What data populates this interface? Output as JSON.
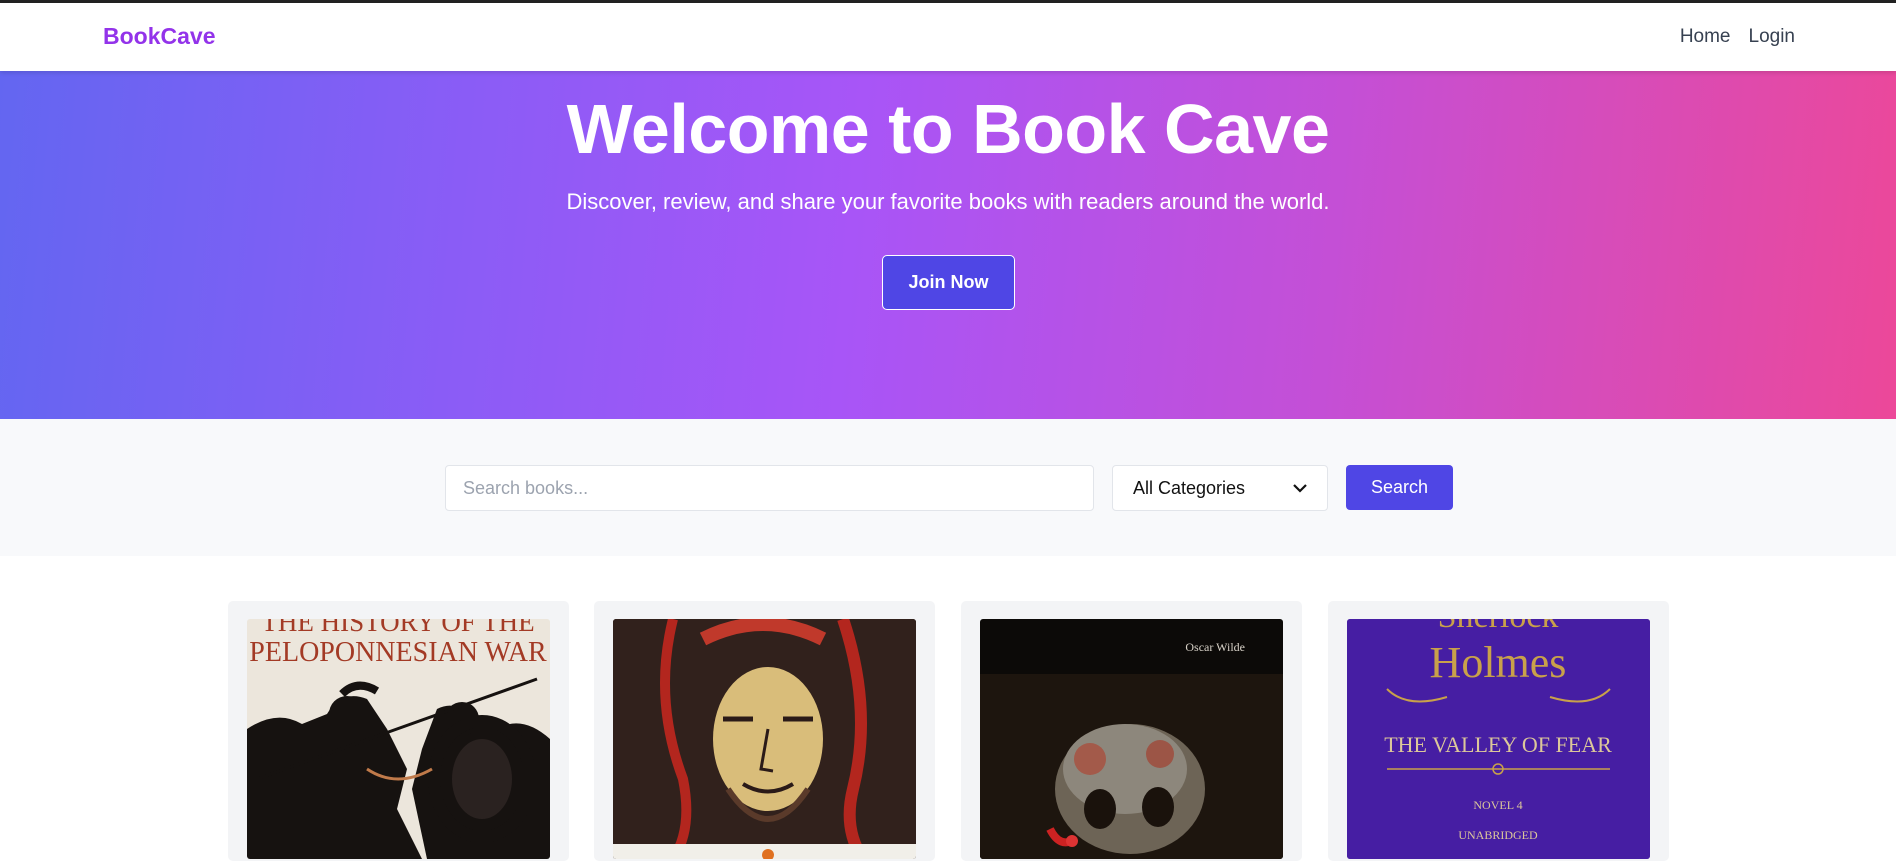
{
  "nav": {
    "brand": "BookCave",
    "links": [
      "Home",
      "Login"
    ]
  },
  "hero": {
    "title": "Welcome to Book Cave",
    "subtitle": "Discover, review, and share your favorite books with readers around the world.",
    "cta_label": "Join Now"
  },
  "search": {
    "placeholder": "Search books...",
    "category_selected": "All Categories",
    "button_label": "Search"
  },
  "books": [
    {
      "cover_text": [
        "THE HISTORY OF THE",
        "PELOPONNESIAN WAR"
      ]
    },
    {
      "cover_text": []
    },
    {
      "cover_text": [
        "Oscar Wilde"
      ]
    },
    {
      "cover_text": [
        "Sherlock",
        "Holmes",
        "THE VALLEY OF FEAR",
        "NOVEL 4",
        "UNABRIDGED"
      ]
    }
  ],
  "colors": {
    "brand": "#9333ea",
    "accent": "#4f46e5",
    "hero_start": "#6366f1",
    "hero_end": "#ec4899"
  }
}
